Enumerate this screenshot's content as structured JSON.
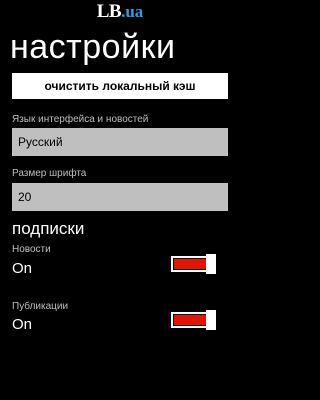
{
  "header": {
    "logo_main": "LB",
    "logo_suffix": ".ua"
  },
  "page_title": "настройки",
  "clear_cache_button": "очистить локальный кэш",
  "language": {
    "label": "Язык интерфейса и новостей",
    "value": "Русский"
  },
  "font_size": {
    "label": "Размер шрифта",
    "value": "20"
  },
  "subscriptions": {
    "title": "подписки",
    "items": [
      {
        "label": "Новости",
        "state": "On",
        "enabled": true
      },
      {
        "label": "Публикации",
        "state": "On",
        "enabled": true
      }
    ]
  },
  "colors": {
    "accent": "#e51400",
    "field_bg": "#bfbfbf",
    "background": "#000000",
    "logo_ua": "#2aa0e0"
  }
}
